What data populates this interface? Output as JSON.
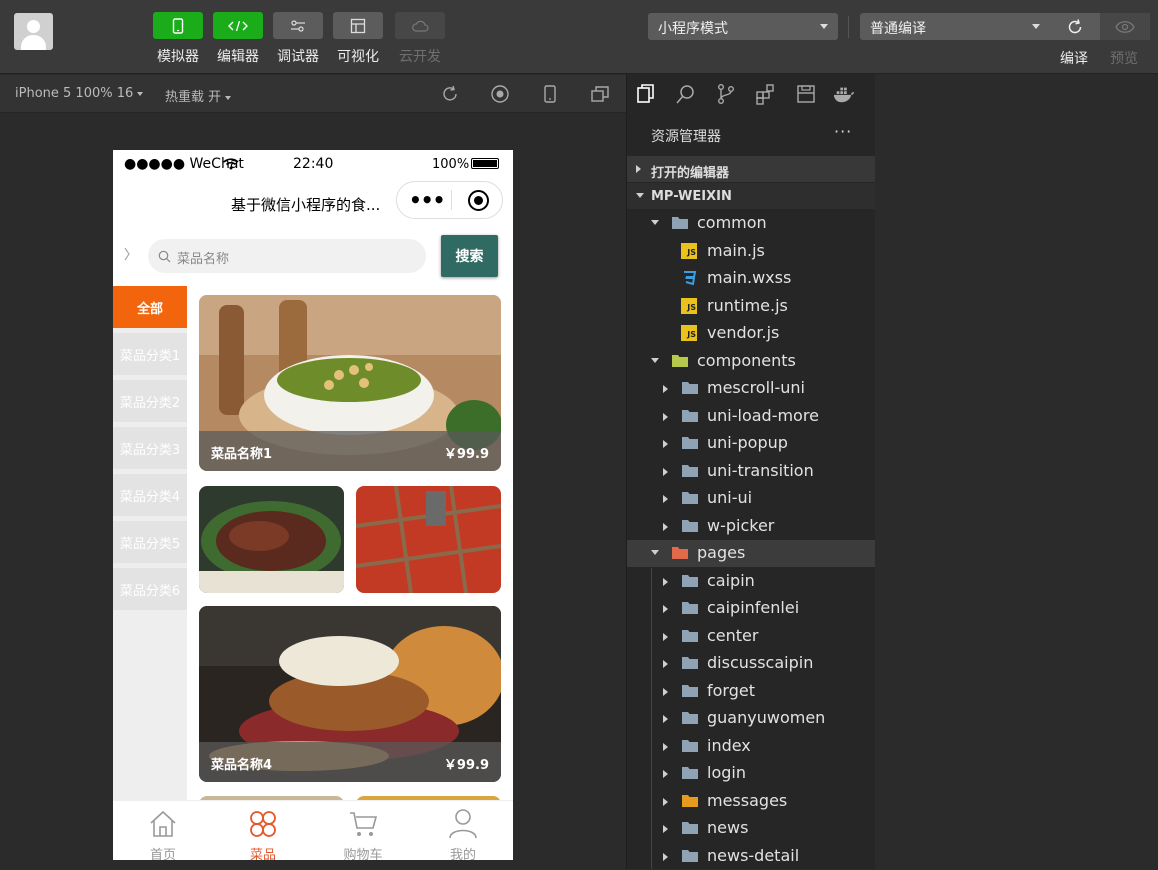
{
  "toolbar": {
    "tools": [
      {
        "label": "模拟器",
        "icon": "phone-icon"
      },
      {
        "label": "编辑器",
        "icon": "code-icon"
      },
      {
        "label": "调试器",
        "icon": "debug-icon"
      },
      {
        "label": "可视化",
        "icon": "layout-icon"
      },
      {
        "label": "云开发",
        "icon": "cloud-icon"
      }
    ],
    "mode_select": "小程序模式",
    "compile_select": "普通编译",
    "compile_label": "编译",
    "preview_label": "预览"
  },
  "subbar": {
    "device": "iPhone 5 100% 16",
    "hot_reload": "热重载 开"
  },
  "phone": {
    "status": {
      "carrier": "●●●●● WeChat",
      "time": "22:40",
      "battery": "100%"
    },
    "nav_title": "基于微信小程序的食...",
    "search_placeholder": "菜品名称",
    "search_button": "搜索",
    "categories": [
      "全部",
      "菜品分类1",
      "菜品分类2",
      "菜品分类3",
      "菜品分类4",
      "菜品分类5",
      "菜品分类6"
    ],
    "cards": [
      {
        "name": "菜品名称1",
        "price": "￥99.9"
      },
      {
        "name": "菜品名称4",
        "price": "￥99.9"
      }
    ],
    "tabs": [
      {
        "label": "首页",
        "icon": "home-icon"
      },
      {
        "label": "菜品",
        "icon": "clover-icon"
      },
      {
        "label": "购物车",
        "icon": "cart-icon"
      },
      {
        "label": "我的",
        "icon": "user-icon"
      }
    ]
  },
  "explorer": {
    "title": "资源管理器",
    "more": "···",
    "open_editors": "打开的编辑器",
    "project": "MP-WEIXIN",
    "tree": [
      {
        "label": "common",
        "type": "folder-open",
        "level": 1
      },
      {
        "label": "main.js",
        "type": "js",
        "level": 2
      },
      {
        "label": "main.wxss",
        "type": "css",
        "level": 2
      },
      {
        "label": "runtime.js",
        "type": "js",
        "level": 2
      },
      {
        "label": "vendor.js",
        "type": "js",
        "level": 2
      },
      {
        "label": "components",
        "type": "folder-open-special",
        "level": 1
      },
      {
        "label": "mescroll-uni",
        "type": "folder",
        "level": 2
      },
      {
        "label": "uni-load-more",
        "type": "folder",
        "level": 2
      },
      {
        "label": "uni-popup",
        "type": "folder",
        "level": 2
      },
      {
        "label": "uni-transition",
        "type": "folder",
        "level": 2
      },
      {
        "label": "uni-ui",
        "type": "folder",
        "level": 2
      },
      {
        "label": "w-picker",
        "type": "folder",
        "level": 2
      },
      {
        "label": "pages",
        "type": "folder-open-red",
        "level": 1
      },
      {
        "label": "caipin",
        "type": "folder",
        "level": 2
      },
      {
        "label": "caipinfenlei",
        "type": "folder",
        "level": 2
      },
      {
        "label": "center",
        "type": "folder",
        "level": 2
      },
      {
        "label": "discusscaipin",
        "type": "folder",
        "level": 2
      },
      {
        "label": "forget",
        "type": "folder",
        "level": 2
      },
      {
        "label": "guanyuwomen",
        "type": "folder",
        "level": 2
      },
      {
        "label": "index",
        "type": "folder",
        "level": 2
      },
      {
        "label": "login",
        "type": "folder",
        "level": 2
      },
      {
        "label": "messages",
        "type": "folder-orange",
        "level": 2
      },
      {
        "label": "news",
        "type": "folder",
        "level": 2
      },
      {
        "label": "news-detail",
        "type": "folder",
        "level": 2
      }
    ]
  },
  "colors": {
    "accent_green": "#1aad19",
    "active_tab": "#e4582b",
    "category_active": "#f2650d",
    "search_btn": "#2f6b63"
  }
}
